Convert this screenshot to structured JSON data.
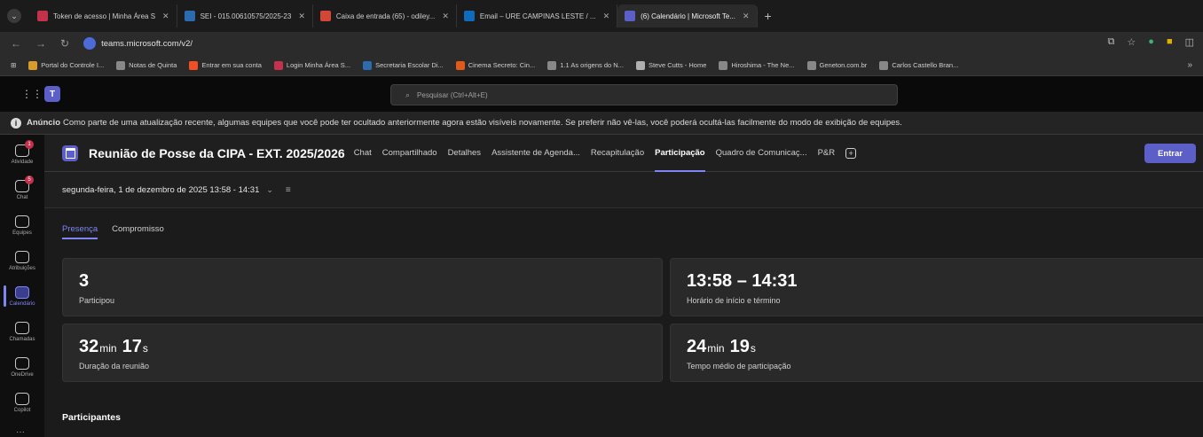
{
  "browser": {
    "tabs": [
      {
        "label": "Token de acesso | Minha Área S",
        "color": "#c4314b"
      },
      {
        "label": "SEI - 015.00610575/2025-23",
        "color": "#2b6cb0"
      },
      {
        "label": "Caixa de entrada (65) - odiley...",
        "color": "#d44638"
      },
      {
        "label": "Email – URE CAMPINAS LESTE / ...",
        "color": "#0f6cbd"
      },
      {
        "label": "(6) Calendário | Microsoft Te...",
        "color": "#5b5fc7"
      }
    ],
    "url": "teams.microsoft.com/v2/",
    "bookmarks": [
      "Portal do Controle I...",
      "Notas de Quinta",
      "Entrar em sua conta",
      "Login Minha Área S...",
      "Secretaria Escolar Di...",
      "Cinema Secreto: Cin...",
      "1.1 As origens do N...",
      "Steve Cutts - Home",
      "Hiroshima - The Ne...",
      "Geneton.com.br",
      "Carlos Castello Bran..."
    ]
  },
  "teams": {
    "search_placeholder": "Pesquisar (Ctrl+Alt+E)",
    "banner_label": "Anúncio",
    "banner_text": "Como parte de uma atualização recente, algumas equipes que você pode ter ocultado anteriormente agora estão visíveis novamente. Se preferir não vê-las, você poderá ocultá-las facilmente do modo de exibição de equipes.",
    "rail": [
      {
        "label": "Atividade",
        "badge": "1"
      },
      {
        "label": "Chat",
        "badge": "5"
      },
      {
        "label": "Equipes"
      },
      {
        "label": "Atribuições"
      },
      {
        "label": "Calendário"
      },
      {
        "label": "Chamadas"
      },
      {
        "label": "OneDrive"
      },
      {
        "label": "Copilot"
      }
    ]
  },
  "meeting": {
    "title": "Reunião de Posse da CIPA - EXT. 2025/2026",
    "tabs": [
      "Chat",
      "Compartilhado",
      "Detalhes",
      "Assistente de Agenda...",
      "Recapitulação",
      "Participação",
      "Quadro de Comunicaç...",
      "P&R"
    ],
    "join_label": "Entrar",
    "date_text": "segunda-feira, 1 de dezembro de 2025 13:58 - 14:31"
  },
  "attendance": {
    "subtabs": [
      "Presença",
      "Compromisso"
    ],
    "participated_value": "3",
    "participated_label": "Participou",
    "time_range": "13:58 – 14:31",
    "time_label": "Horário de início e término",
    "duration_min": "32",
    "duration_sec": "17",
    "duration_label": "Duração da reunião",
    "avg_min": "24",
    "avg_sec": "19",
    "avg_label": "Tempo médio de participação",
    "min_unit": "min",
    "sec_unit": "s",
    "participants_title": "Participantes"
  }
}
